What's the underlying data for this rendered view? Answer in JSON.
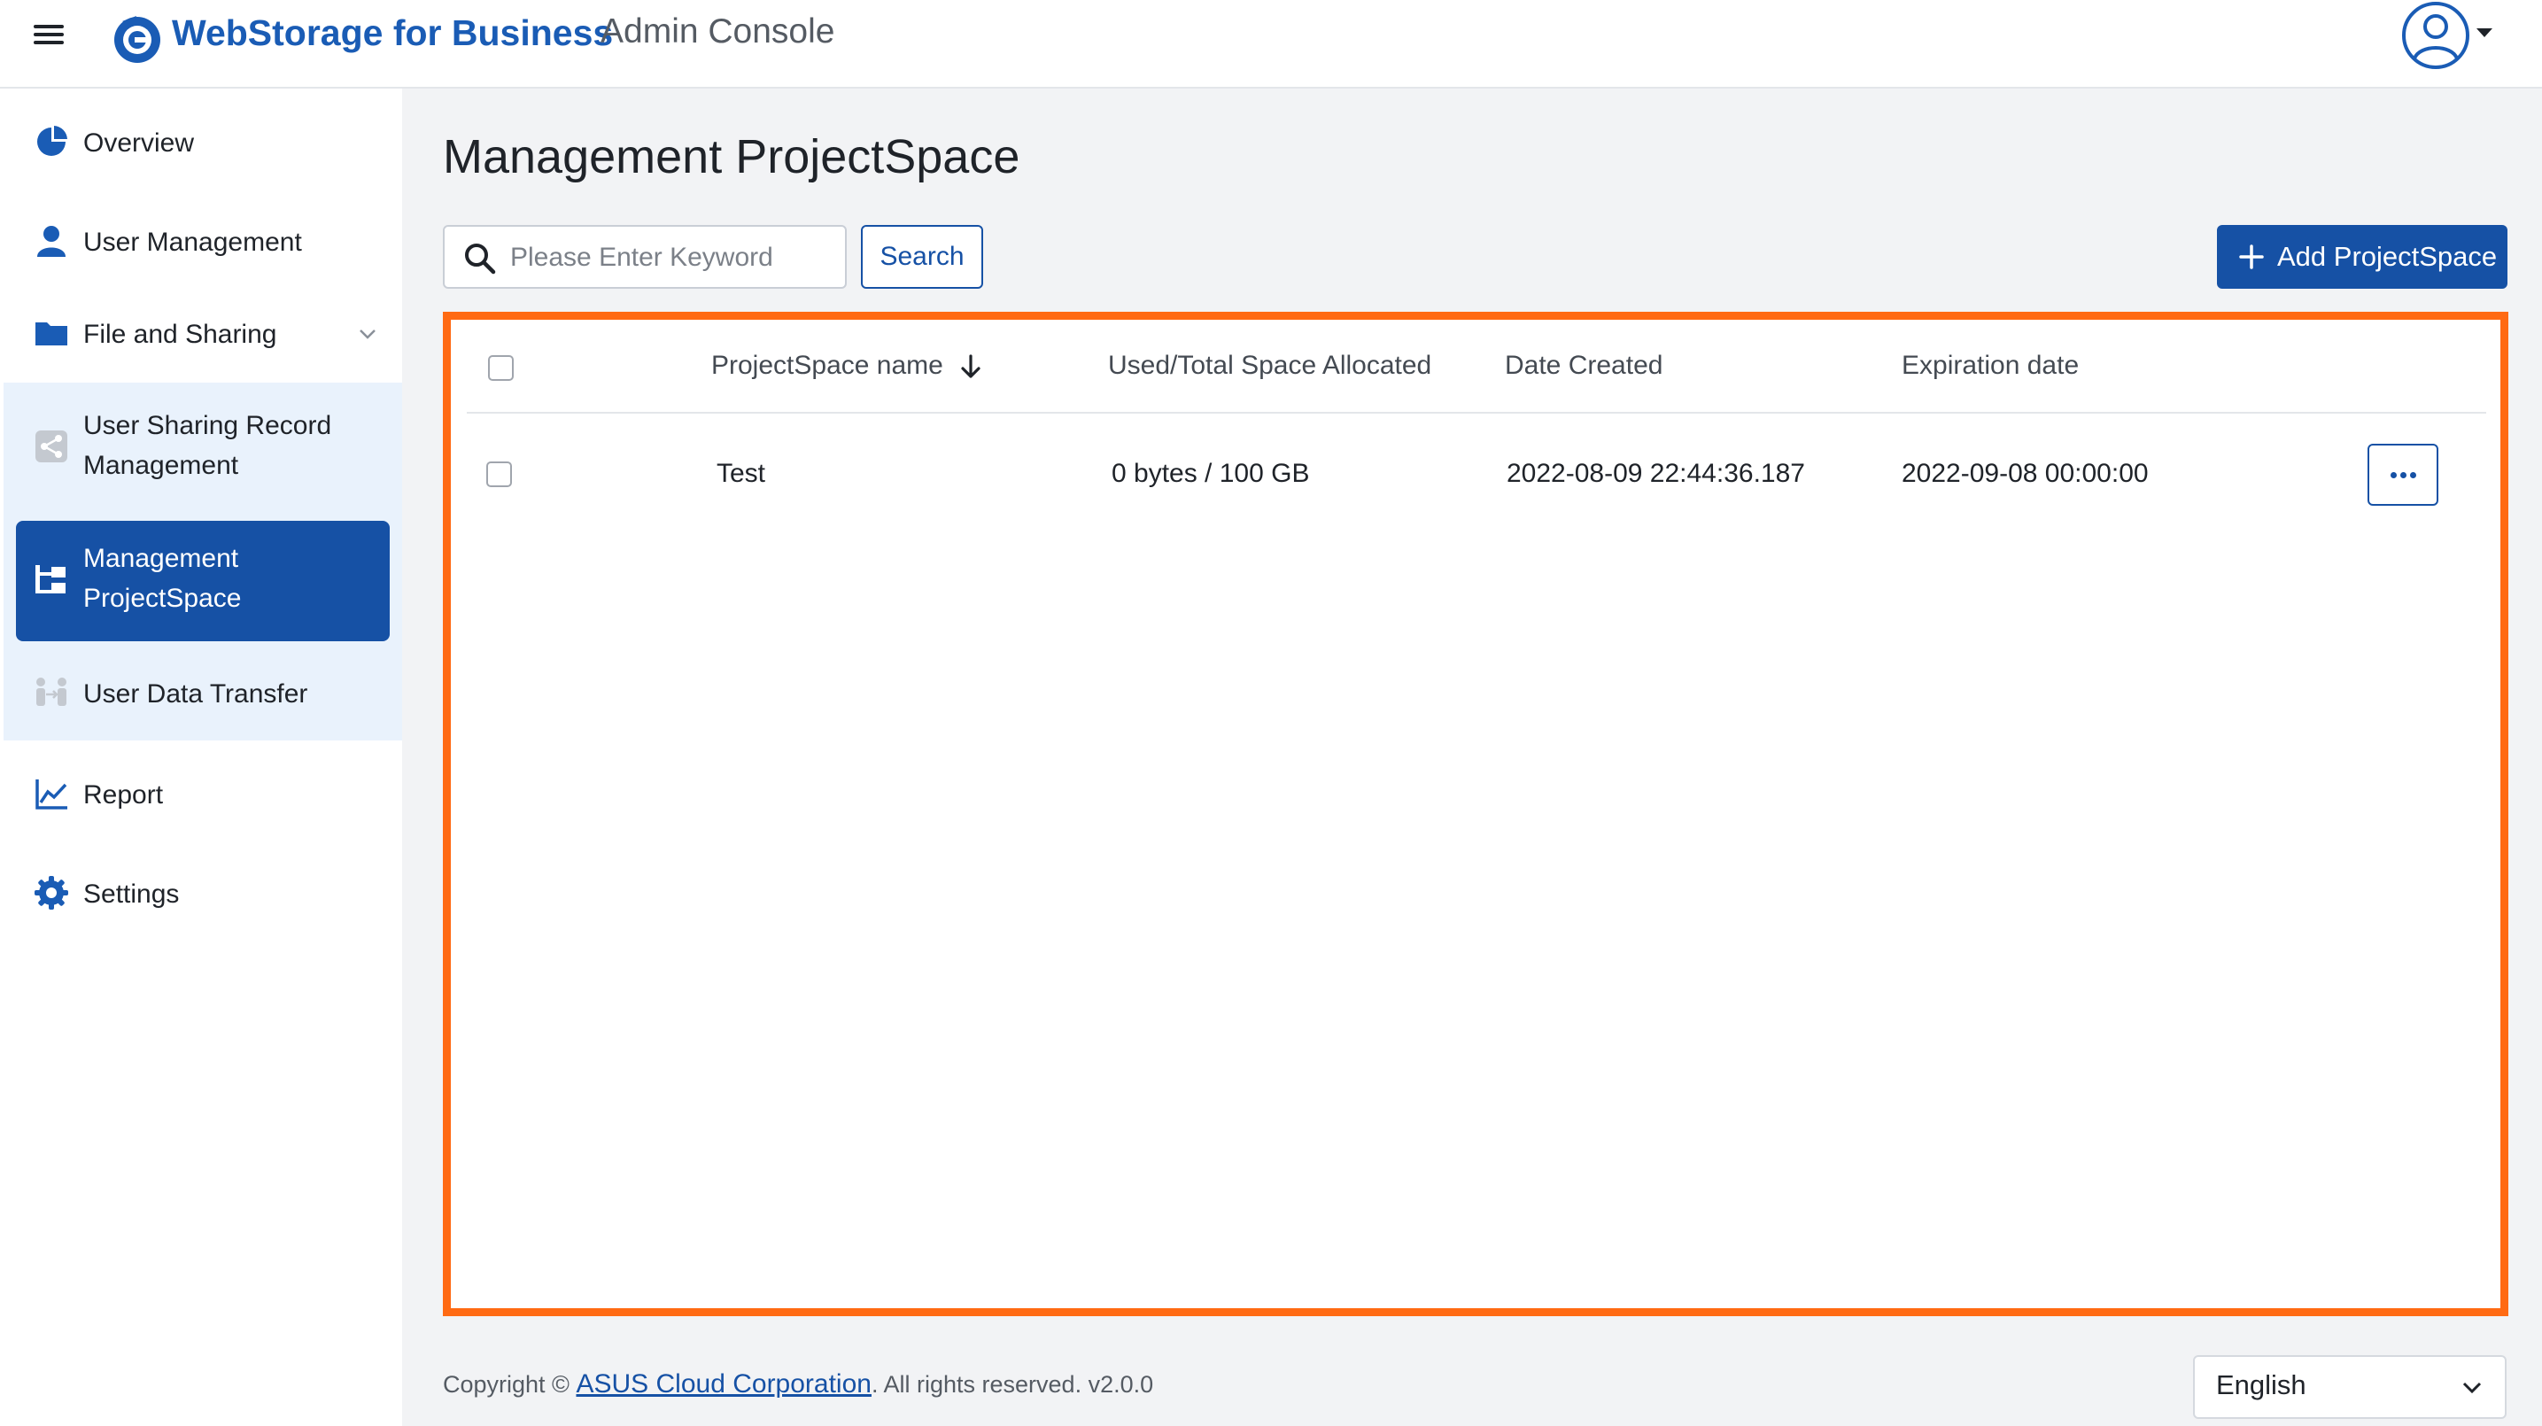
{
  "header": {
    "brand": "WebStorage for Business",
    "subtitle": "Admin Console",
    "icons": [
      "menu-icon",
      "webstorage-logo-icon",
      "user-avatar-icon",
      "caret-down-icon"
    ]
  },
  "sidebar": {
    "items": [
      {
        "label": "Overview",
        "icon": "pie-chart-icon"
      },
      {
        "label": "User Management",
        "icon": "user-icon"
      },
      {
        "label": "File and Sharing",
        "icon": "folder-icon"
      },
      {
        "label": "User Sharing Record Management",
        "icon": "share-icon"
      },
      {
        "label": "Management ProjectSpace",
        "icon": "hierarchy-icon",
        "active": true
      },
      {
        "label": "User Data Transfer",
        "icon": "transfer-icon"
      },
      {
        "label": "Report",
        "icon": "line-chart-icon"
      },
      {
        "label": "Settings",
        "icon": "gear-icon"
      }
    ],
    "sharing_record_line1": "User Sharing Record",
    "sharing_record_line2": "Management",
    "projectspace_line1": "Management",
    "projectspace_line2": "ProjectSpace"
  },
  "main": {
    "title": "Management ProjectSpace",
    "search": {
      "placeholder": "Please Enter Keyword",
      "value": "",
      "button": "Search"
    },
    "add_button": "Add ProjectSpace",
    "table": {
      "columns": [
        "ProjectSpace name",
        "Used/Total Space Allocated",
        "Date Created",
        "Expiration date"
      ],
      "sort_column": "ProjectSpace name",
      "sort_direction": "descending",
      "rows": [
        {
          "name": "Test",
          "space": "0 bytes / 100 GB",
          "created": "2022-08-09 22:44:36.187",
          "expires": "2022-09-08 00:00:00"
        }
      ]
    }
  },
  "footer": {
    "copyright_prefix": "Copyright ©",
    "company": "ASUS Cloud Corporation",
    "suffix": ". All rights reserved. v2.0.0",
    "language": "English"
  },
  "colors": {
    "primary": "#1651a5",
    "highlight_border": "#ff6a13",
    "sidebar_sub_bg": "#e9f2fc",
    "main_bg": "#f2f3f5"
  }
}
